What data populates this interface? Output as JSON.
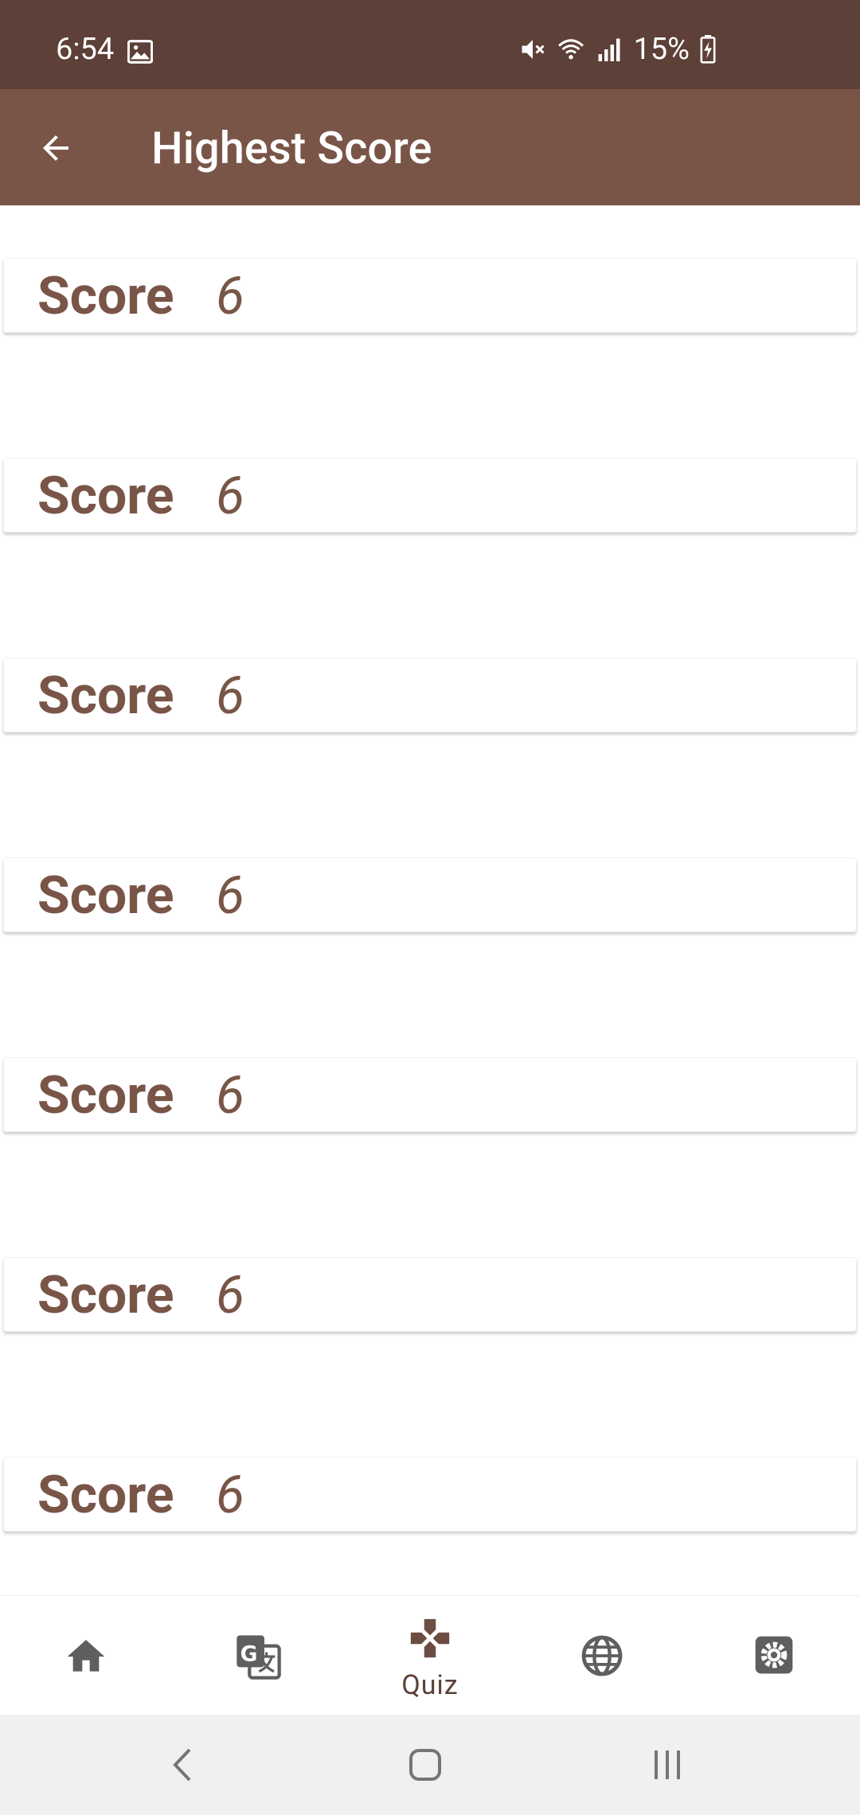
{
  "status_bar": {
    "time": "6:54",
    "battery": "15%",
    "icons": [
      "image-icon",
      "mute-icon",
      "wifi-icon",
      "signal-icon",
      "battery-charging-icon"
    ]
  },
  "app_bar": {
    "back_icon": "arrow-back-icon",
    "title": "Highest Score"
  },
  "scores": [
    {
      "label": "Score",
      "value": "6"
    },
    {
      "label": "Score",
      "value": "6"
    },
    {
      "label": "Score",
      "value": "6"
    },
    {
      "label": "Score",
      "value": "6"
    },
    {
      "label": "Score",
      "value": "6"
    },
    {
      "label": "Score",
      "value": "6"
    },
    {
      "label": "Score",
      "value": "6"
    }
  ],
  "bottom_nav": {
    "items": [
      {
        "icon": "home-icon",
        "label": ""
      },
      {
        "icon": "translate-icon",
        "label": ""
      },
      {
        "icon": "quiz-gamepad-icon",
        "label": "Quiz"
      },
      {
        "icon": "globe-icon",
        "label": ""
      },
      {
        "icon": "settings-icon",
        "label": ""
      }
    ],
    "active_index": 2
  },
  "system_nav": {
    "buttons": [
      "back-chevron-icon",
      "home-square-icon",
      "recents-icon"
    ]
  },
  "colors": {
    "status_bar": "#5D4037",
    "app_bar": "#795548",
    "accent": "#795548",
    "system_nav": "#f0f0f0"
  }
}
